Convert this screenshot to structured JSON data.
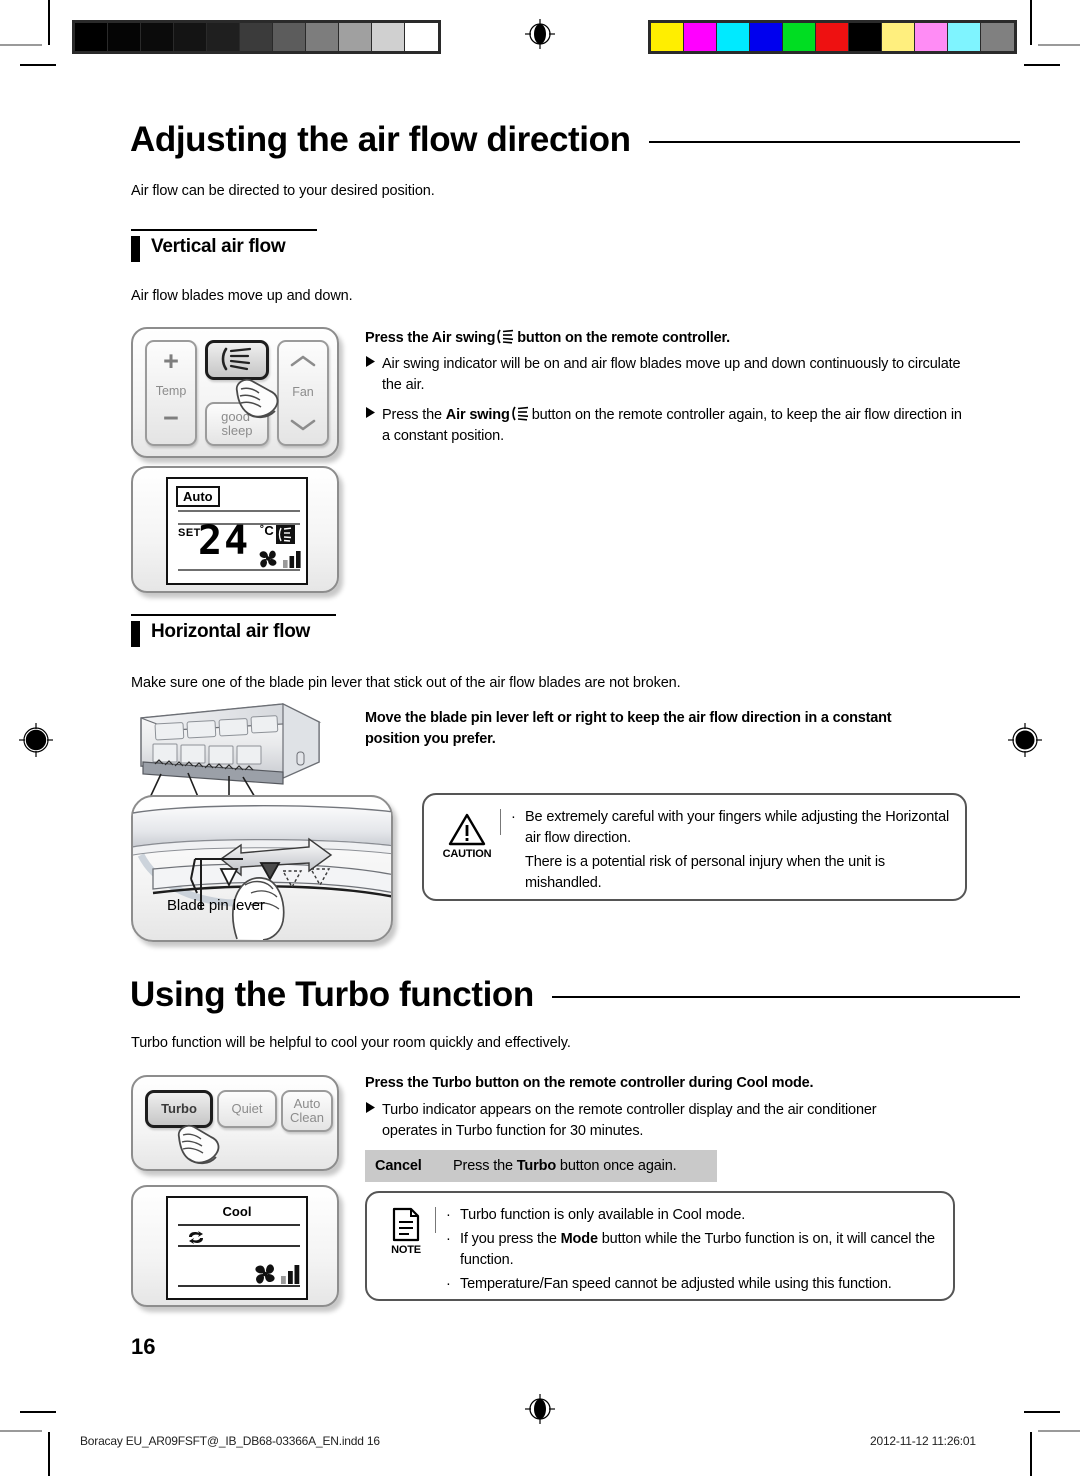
{
  "document": {
    "page_number": "16",
    "footer_left": "Boracay EU_AR09FSFT@_IB_DB68-03366A_EN.indd   16",
    "footer_right": "2012-11-12   11:26:01"
  },
  "calibration": {
    "greyscale_label": "greyscale-step-wedge",
    "greyscale_steps": [
      "#000000",
      "#050505",
      "#0b0b0b",
      "#141414",
      "#1f1f1f",
      "#3b3b3b",
      "#5c5c5c",
      "#7d7d7d",
      "#a0a0a0",
      "#d0d0d0",
      "#ffffff"
    ],
    "color_label": "color-control-bar",
    "color_steps": [
      "#ffee00",
      "#ff00ff",
      "#00eaff",
      "#0000ee",
      "#00dd22",
      "#ee1111",
      "#000000",
      "#ffef7e",
      "#ff8cf5",
      "#7ff4ff",
      "#808080"
    ]
  },
  "section1": {
    "title": "Adjusting the air flow direction",
    "intro": "Air flow can be directed to your desired position.",
    "vertical": {
      "heading": "Vertical air flow",
      "intro": "Air flow blades move up and down.",
      "lead_prefix": "Press the ",
      "lead_bold": "Air swing",
      "lead_suffix": "button on the remote controller.",
      "bullets": [
        {
          "parts": [
            {
              "text": "Air swing indicator will be on and air flow blades move up and down continuously to circulate the air.",
              "bold": false
            }
          ]
        },
        {
          "parts": [
            {
              "text": "Press the ",
              "bold": false
            },
            {
              "text": "Air swing",
              "bold": true
            },
            {
              "text": " ",
              "bold": false
            },
            {
              "icon": "air-swing-icon"
            },
            {
              "text": "button on the remote controller again, to keep the air flow direction in a constant position.",
              "bold": false
            }
          ]
        }
      ],
      "remote": {
        "temp_label": "Temp",
        "temp_plus": "+",
        "temp_minus": "−",
        "swing_button": "air-swing-button",
        "good_sleep_line1": "good’",
        "good_sleep_line2": "sleep",
        "fan_label": "Fan",
        "fan_up": "fan-up-chevron",
        "fan_down": "fan-down-chevron",
        "hand": "pressing-hand-icon"
      },
      "display": {
        "mode_badge": "Auto",
        "set_label": "SET",
        "temperature": "24",
        "unit": "˚C",
        "swing_indicator": "air-swing-indicator-icon",
        "fan_icon": "fan-speed-icon"
      }
    },
    "horizontal": {
      "heading": "Horizontal air flow",
      "intro": "Make sure one of the blade pin lever that stick out of the air flow blades are not broken.",
      "lead": "Move the blade pin lever left or right to keep the air flow direction in a constant position you prefer.",
      "illustration_caption": "Blade pin lever",
      "caution": {
        "label": "CAUTION",
        "items": [
          "Be extremely careful with your fingers while adjusting the Horizontal air flow direction.",
          "There is a potential risk of personal injury when the unit is mishandled."
        ]
      }
    }
  },
  "section2": {
    "title": "Using the Turbo function",
    "intro": "Turbo function will be helpful to cool your room quickly and effectively.",
    "lead_prefix": "Press the ",
    "lead_bold": "Turbo",
    "lead_suffix": " button on the remote controller during Cool mode.",
    "bullets": [
      "Turbo indicator appears on the remote controller display and the air conditioner operates in Turbo function for 30 minutes."
    ],
    "cancel": {
      "label": "Cancel",
      "prefix": "Press the ",
      "bold": "Turbo",
      "suffix": " button once again."
    },
    "remote": {
      "turbo_button": "Turbo",
      "quiet_button": "Quiet",
      "auto_clean_line1": "Auto",
      "auto_clean_line2": "Clean",
      "hand": "pressing-hand-icon"
    },
    "display": {
      "mode": "Cool",
      "turbo_indicator": "turbo-indicator-icon",
      "fan_icon": "fan-speed-icon"
    },
    "note": {
      "label": "NOTE",
      "items": [
        {
          "parts": [
            {
              "text": "Turbo function is only available in Cool mode.",
              "bold": false
            }
          ]
        },
        {
          "parts": [
            {
              "text": "If you press the ",
              "bold": false
            },
            {
              "text": "Mode",
              "bold": true
            },
            {
              "text": " button while the Turbo function is on, it will cancel the function.",
              "bold": false
            }
          ]
        },
        {
          "parts": [
            {
              "text": "Temperature/Fan speed cannot be adjusted while using this function.",
              "bold": false
            }
          ]
        }
      ]
    }
  }
}
